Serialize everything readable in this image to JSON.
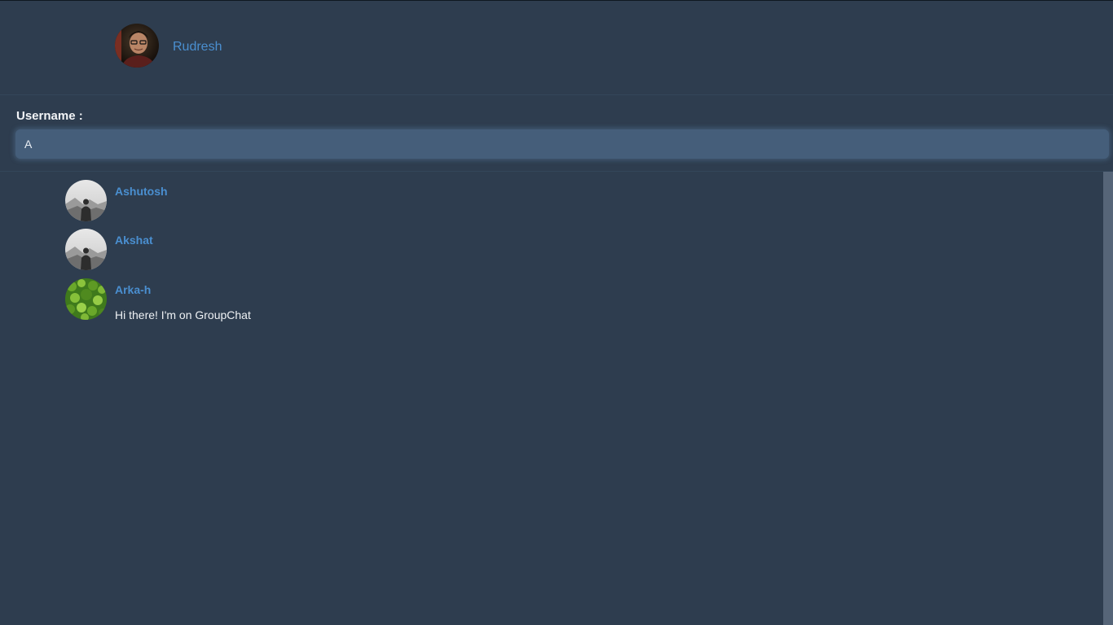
{
  "header": {
    "current_user": {
      "name": "Rudresh",
      "avatar_icon": "profile-photo-icon"
    }
  },
  "search": {
    "label": "Username :",
    "value": "A",
    "placeholder": ""
  },
  "results": [
    {
      "name": "Ashutosh",
      "status": "",
      "avatar_icon": "default-silhouette-avatar-icon"
    },
    {
      "name": "Akshat",
      "status": "",
      "avatar_icon": "default-silhouette-avatar-icon"
    },
    {
      "name": "Arka-h",
      "status": "Hi there! I'm on GroupChat",
      "avatar_icon": "leaves-avatar-icon"
    }
  ],
  "colors": {
    "background": "#2e3d4f",
    "accent_name": "#4a8fd0",
    "input_bg": "#455e7a",
    "scrollbar": "#566578"
  }
}
